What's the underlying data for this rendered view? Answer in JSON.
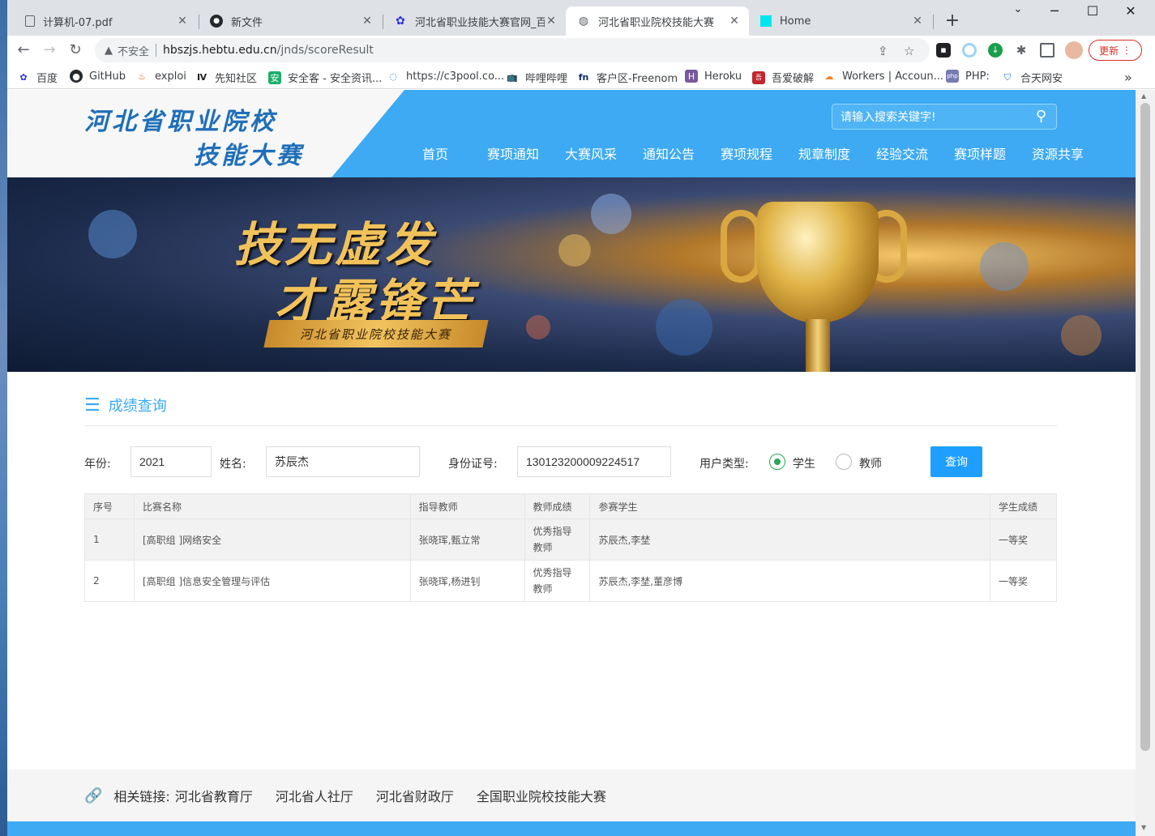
{
  "tabs": [
    {
      "title": "计算机-07.pdf",
      "icon": "pdf-icon"
    },
    {
      "title": "新文件",
      "icon": "github-icon"
    },
    {
      "title": "河北省职业技能大赛官网_百度",
      "icon": "baidu-icon"
    },
    {
      "title": "河北省职业院校技能大赛",
      "icon": "globe-icon",
      "active": true
    },
    {
      "title": "Home",
      "icon": "cyan-square-icon"
    }
  ],
  "toolbar": {
    "insecure_label": "不安全",
    "url_host": "hbszjs.hebtu.edu.cn",
    "url_path": "/jnds/scoreResult",
    "update_label": "更新"
  },
  "bookmarks": [
    "百度",
    "GitHub",
    "exploi",
    "先知社区",
    "安全客 - 安全资讯...",
    "https://c3pool.co...",
    "哔哩哔哩",
    "客户区-Freenom",
    "Heroku",
    "吾爱破解",
    "Workers | Accoun...",
    "PHP:",
    "合天网安"
  ],
  "site": {
    "logo_line1": "河北省职业院校",
    "logo_line2": "技能大赛",
    "search_placeholder": "请输入搜索关键字!",
    "nav": [
      "首页",
      "赛项通知",
      "大赛风采",
      "通知公告",
      "赛项规程",
      "规章制度",
      "经验交流",
      "赛项样题",
      "资源共享"
    ],
    "banner_line1": "技无虚发",
    "banner_line2": "才露锋芒",
    "banner_ribbon": "河北省职业院校技能大赛"
  },
  "query": {
    "section_title": "成绩查询",
    "year_label": "年份:",
    "year_value": "2021",
    "name_label": "姓名:",
    "name_value": "苏辰杰",
    "id_label": "身份证号:",
    "id_value": "130123200009224517",
    "user_type_label": "用户类型:",
    "user_types": [
      "学生",
      "教师"
    ],
    "selected_type": "学生",
    "button_label": "查询"
  },
  "table": {
    "headers": [
      "序号",
      "比赛名称",
      "指导教师",
      "教师成绩",
      "参赛学生",
      "学生成绩"
    ],
    "rows": [
      [
        "1",
        "[高职组 ]网络安全",
        "张晓珲,甄立常",
        "优秀指导教师",
        "苏辰杰,李埜",
        "一等奖"
      ],
      [
        "2",
        "[高职组 ]信息安全管理与评估",
        "张晓珲,杨进钊",
        "优秀指导教师",
        "苏辰杰,李埜,董彦博",
        "一等奖"
      ]
    ]
  },
  "footer": {
    "label": "相关链接:",
    "links": [
      "河北省教育厅",
      "河北省人社厅",
      "河北省财政厅",
      "全国职业院校技能大赛"
    ]
  },
  "colors": {
    "accent": "#3daaf3",
    "button": "#1e9fff",
    "radio_checked": "#2ca55a"
  }
}
